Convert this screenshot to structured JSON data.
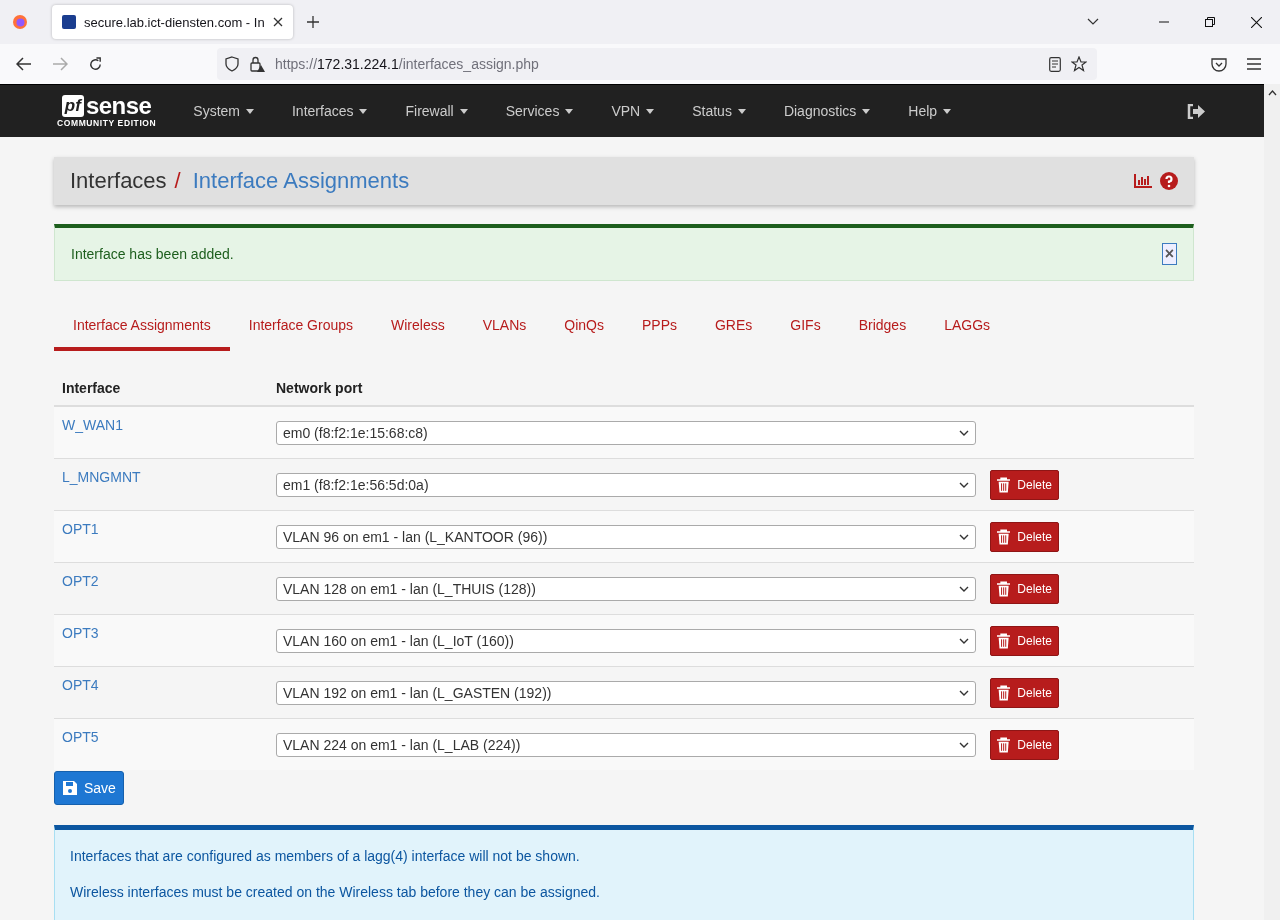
{
  "browser": {
    "tab_title": "secure.lab.ict-diensten.com - In",
    "url": {
      "scheme": "https://",
      "host": "172.31.224.1",
      "path": "/interfaces_assign.php"
    }
  },
  "navbar": {
    "logo": "sense",
    "logo_mark": "pf",
    "logo_sub": "COMMUNITY EDITION",
    "menus": [
      "System",
      "Interfaces",
      "Firewall",
      "Services",
      "VPN",
      "Status",
      "Diagnostics",
      "Help"
    ]
  },
  "breadcrumb": {
    "section": "Interfaces",
    "separator": "/",
    "page": "Interface Assignments"
  },
  "alert": {
    "message": "Interface has been added.",
    "close": "×"
  },
  "tabs": [
    {
      "label": "Interface Assignments",
      "selected": true
    },
    {
      "label": "Interface Groups",
      "selected": false
    },
    {
      "label": "Wireless",
      "selected": false
    },
    {
      "label": "VLANs",
      "selected": false
    },
    {
      "label": "QinQs",
      "selected": false
    },
    {
      "label": "PPPs",
      "selected": false
    },
    {
      "label": "GREs",
      "selected": false
    },
    {
      "label": "GIFs",
      "selected": false
    },
    {
      "label": "Bridges",
      "selected": false
    },
    {
      "label": "LAGGs",
      "selected": false
    }
  ],
  "table": {
    "columns": [
      "Interface",
      "Network port"
    ],
    "rows": [
      {
        "interface": "W_WAN1",
        "port": "em0 (f8:f2:1e:15:68:c8)"
      },
      {
        "interface": "L_MNGMNT",
        "port": "em1 (f8:f2:1e:56:5d:0a)",
        "delete": "Delete"
      },
      {
        "interface": "OPT1",
        "port": "VLAN 96 on em1 - lan (L_KANTOOR (96))",
        "delete": "Delete"
      },
      {
        "interface": "OPT2",
        "port": "VLAN 128 on em1 - lan (L_THUIS (128))",
        "delete": "Delete"
      },
      {
        "interface": "OPT3",
        "port": "VLAN 160 on em1 - lan (L_IoT (160))",
        "delete": "Delete"
      },
      {
        "interface": "OPT4",
        "port": "VLAN 192 on em1 - lan (L_GASTEN (192))",
        "delete": "Delete"
      },
      {
        "interface": "OPT5",
        "port": "VLAN 224 on em1 - lan (L_LAB (224))",
        "delete": "Delete"
      }
    ]
  },
  "save_label": "Save",
  "info": [
    "Interfaces that are configured as members of a lagg(4) interface will not be shown.",
    "Wireless interfaces must be created on the Wireless tab before they can be assigned."
  ]
}
